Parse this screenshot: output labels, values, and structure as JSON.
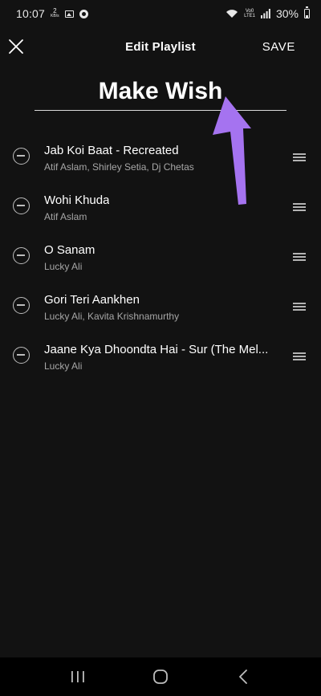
{
  "status_bar": {
    "time": "10:07",
    "net_speed_value": "2",
    "net_speed_unit": "KB/s",
    "volte_top": "Vo0",
    "volte_bottom": "LTE1",
    "battery_percent": "30%"
  },
  "header": {
    "title": "Edit Playlist",
    "save_label": "SAVE"
  },
  "playlist": {
    "name": "Make Wish"
  },
  "tracks": [
    {
      "title": "Jab Koi Baat - Recreated",
      "artist": "Atif Aslam, Shirley Setia, Dj Chetas"
    },
    {
      "title": "Wohi Khuda",
      "artist": "Atif Aslam"
    },
    {
      "title": "O Sanam",
      "artist": "Lucky Ali"
    },
    {
      "title": "Gori Teri Aankhen",
      "artist": "Lucky Ali, Kavita Krishnamurthy"
    },
    {
      "title": "Jaane Kya Dhoondta Hai - Sur (The Mel...",
      "artist": "Lucky Ali"
    }
  ],
  "icons": {
    "close": "close-icon",
    "remove": "minus-circle-icon",
    "drag": "drag-handle-icon",
    "annotation": "arrow-annotation",
    "nav_recents": "recents-icon",
    "nav_home": "home-icon",
    "nav_back": "back-icon"
  },
  "colors": {
    "background": "#121212",
    "accent_arrow": "#a573f0",
    "secondary_text": "#a7a7a7"
  }
}
